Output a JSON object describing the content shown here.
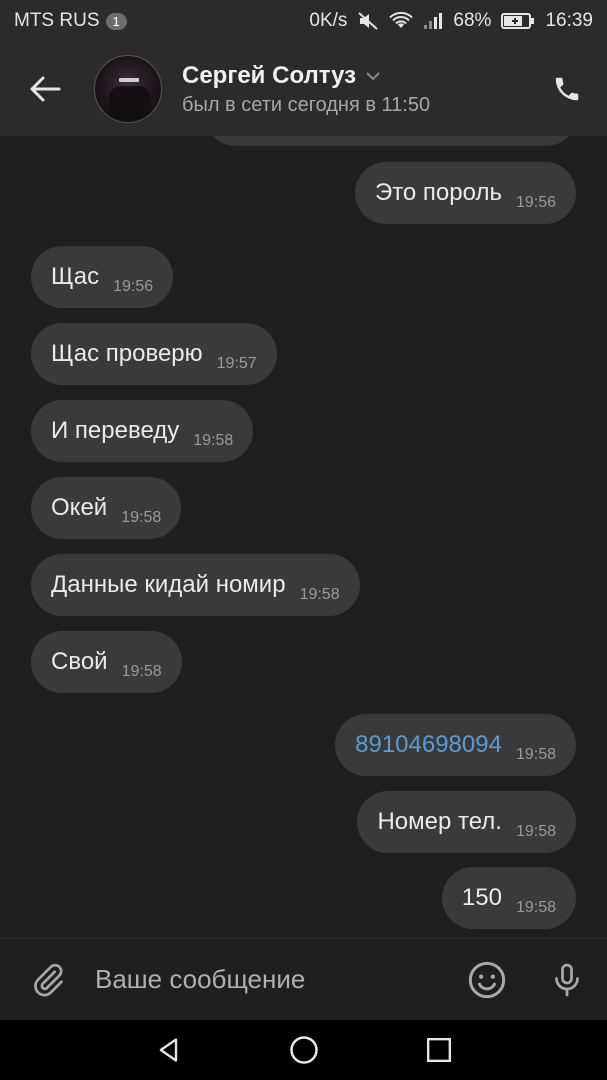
{
  "status_bar": {
    "carrier": "MTS RUS",
    "sim_badge": "1",
    "net_speed": "0K/s",
    "battery_percent": "68%",
    "time": "16:39"
  },
  "header": {
    "contact_name": "Сергей Солтуз",
    "last_seen": "был в сети сегодня в 11:50"
  },
  "messages": [
    {
      "side": "out",
      "text": "Это пороль",
      "time": "19:56"
    },
    {
      "side": "in",
      "text": "Щас",
      "time": "19:56"
    },
    {
      "side": "in",
      "text": "Щас проверю",
      "time": "19:57"
    },
    {
      "side": "in",
      "text": "И переведу",
      "time": "19:58"
    },
    {
      "side": "in",
      "text": "Окей",
      "time": "19:58"
    },
    {
      "side": "in",
      "text": "Данные кидай номир",
      "time": "19:58"
    },
    {
      "side": "in",
      "text": "Свой",
      "time": "19:58"
    },
    {
      "side": "out",
      "text": "89104698094",
      "time": "19:58",
      "link": true
    },
    {
      "side": "out",
      "text": "Номер тел.",
      "time": "19:58"
    },
    {
      "side": "out",
      "text": "150",
      "time": "19:58"
    }
  ],
  "composer": {
    "placeholder": "Ваше сообщение"
  },
  "icons": {
    "back": "arrow-left-icon",
    "dropdown": "chevron-down-icon",
    "call": "phone-icon",
    "attach": "paperclip-icon",
    "emoji": "smiley-icon",
    "mic": "microphone-icon",
    "nav_back": "triangle-back-icon",
    "nav_home": "circle-home-icon",
    "nav_recents": "square-recents-icon"
  },
  "colors": {
    "background": "#1f1f1f",
    "header": "#2b2b2b",
    "bubble": "#3a3a3a",
    "link": "#5b9bd5"
  }
}
